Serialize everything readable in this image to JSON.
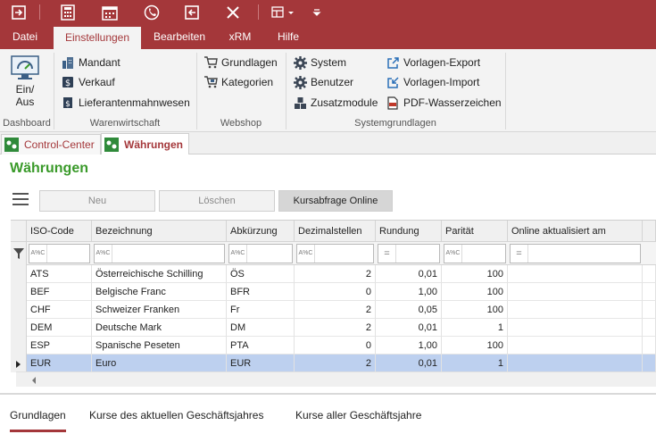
{
  "quick_access": {
    "icons": [
      "exit-icon",
      "calculator-icon",
      "calendar-icon",
      "phone-icon",
      "back-icon",
      "close-icon",
      "layout-dropdown-icon",
      "customize-icon"
    ]
  },
  "ribbon_tabs": [
    "Datei",
    "Einstellungen",
    "Bearbeiten",
    "xRM",
    "Hilfe"
  ],
  "ribbon": {
    "dashboard": {
      "button_label": "Ein/\nAus",
      "group": "Dashboard"
    },
    "warenwirtschaft": {
      "items": [
        "Mandant",
        "Verkauf",
        "Lieferantenmahnwesen"
      ],
      "group": "Warenwirtschaft"
    },
    "webshop": {
      "items": [
        "Grundlagen",
        "Kategorien"
      ],
      "group": "Webshop"
    },
    "systemgrundlagen": {
      "items_left": [
        "System",
        "Benutzer",
        "Zusatzmodule"
      ],
      "items_right": [
        "Vorlagen-Export",
        "Vorlagen-Import",
        "PDF-Wasserzeichen"
      ],
      "group": "Systemgrundlagen"
    }
  },
  "doc_tabs": [
    "Control-Center",
    "Währungen"
  ],
  "page_title": "Währungen",
  "toolbar": {
    "new": "Neu",
    "delete": "Löschen",
    "rate_query": "Kursabfrage Online"
  },
  "grid": {
    "columns": [
      "ISO-Code",
      "Bezeichnung",
      "Abkürzung",
      "Dezimalstellen",
      "Rundung",
      "Parität",
      "Online aktualisiert am"
    ],
    "filter_ops": [
      "A%C",
      "A%C",
      "A%C",
      "A%C",
      "=",
      "A%C",
      "="
    ],
    "rows": [
      [
        "ATS",
        "Österreichische Schilling",
        "ÖS",
        "2",
        "0,01",
        "100",
        ""
      ],
      [
        "BEF",
        "Belgische Franc",
        "BFR",
        "0",
        "1,00",
        "100",
        ""
      ],
      [
        "CHF",
        "Schweizer Franken",
        "Fr",
        "2",
        "0,05",
        "100",
        ""
      ],
      [
        "DEM",
        "Deutsche Mark",
        "DM",
        "2",
        "0,01",
        "1",
        ""
      ],
      [
        "ESP",
        "Spanische Peseten",
        "PTA",
        "0",
        "1,00",
        "100",
        ""
      ],
      [
        "EUR",
        "Euro",
        "EUR",
        "2",
        "0,01",
        "1",
        ""
      ]
    ],
    "selected_row": 5
  },
  "bottom_tabs": [
    "Grundlagen",
    "Kurse des aktuellen Geschäftsjahres",
    "Kurse aller Geschäftsjahre"
  ],
  "colors": {
    "brand": "#a4373a",
    "title_green": "#3a9a2a",
    "selection": "#bdd0ef"
  }
}
